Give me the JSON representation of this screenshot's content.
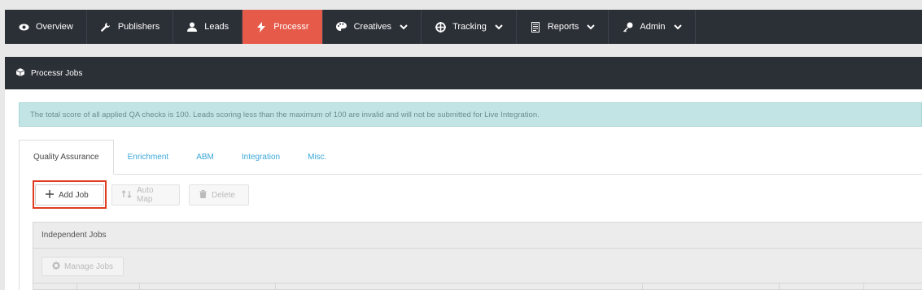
{
  "nav": {
    "items": [
      {
        "label": "Overview",
        "icon": "eye-icon",
        "has_dropdown": false
      },
      {
        "label": "Publishers",
        "icon": "wrench-icon",
        "has_dropdown": false
      },
      {
        "label": "Leads",
        "icon": "user-icon",
        "has_dropdown": false
      },
      {
        "label": "Processr",
        "icon": "bolt-icon",
        "has_dropdown": false,
        "active": true
      },
      {
        "label": "Creatives",
        "icon": "palette-icon",
        "has_dropdown": true
      },
      {
        "label": "Tracking",
        "icon": "crosshair-icon",
        "has_dropdown": true
      },
      {
        "label": "Reports",
        "icon": "report-icon",
        "has_dropdown": true
      },
      {
        "label": "Admin",
        "icon": "key-icon",
        "has_dropdown": true
      }
    ],
    "active_color": "#e65a4a",
    "bar_color": "#2b2f36"
  },
  "panel": {
    "title": "Processr Jobs",
    "icon": "cube-icon"
  },
  "alert": {
    "text": "The total score of all applied QA checks is 100. Leads scoring less than the maximum of 100 are invalid and will not be submitted for Live Integration."
  },
  "tabs": [
    {
      "label": "Quality Assurance",
      "active": true
    },
    {
      "label": "Enrichment"
    },
    {
      "label": "ABM"
    },
    {
      "label": "Integration"
    },
    {
      "label": "Misc."
    }
  ],
  "toolbar": {
    "add_job": "Add Job",
    "auto_map": "Auto Map",
    "delete": "Delete"
  },
  "jobs": {
    "title": "Independent Jobs",
    "manage_label": "Manage Jobs"
  }
}
